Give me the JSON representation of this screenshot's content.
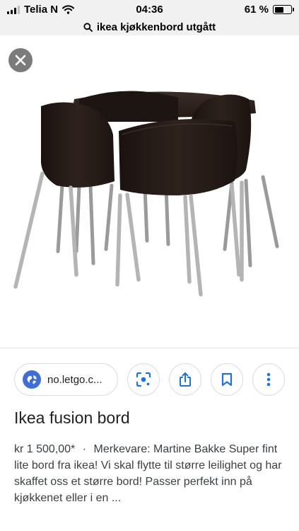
{
  "status_bar": {
    "carrier": "Telia N",
    "time": "04:36",
    "battery_percent": "61 %",
    "battery_level": 0.61
  },
  "url_bar": {
    "query": "ikea kjøkkenbord utgått",
    "icon": "search-icon"
  },
  "image_viewer": {
    "close_icon": "close-icon"
  },
  "actions": {
    "source_label": "no.letgo.c...",
    "source_icon": "globe-icon",
    "buttons": [
      {
        "icon": "lens-icon"
      },
      {
        "icon": "share-icon"
      },
      {
        "icon": "bookmark-icon"
      },
      {
        "icon": "more-vert-icon"
      }
    ],
    "accent": "#1a73e8"
  },
  "result": {
    "title": "Ikea fusion bord",
    "price": "kr 1 500,00*",
    "separator": "·",
    "brand": "Merkevare: Martine Bakke",
    "description": "Super fint lite bord fra ikea! Vi skal flytte til større leilighet og har skaffet oss et større bord! Passer perfekt inn på kjøkkenet eller i en ..."
  }
}
